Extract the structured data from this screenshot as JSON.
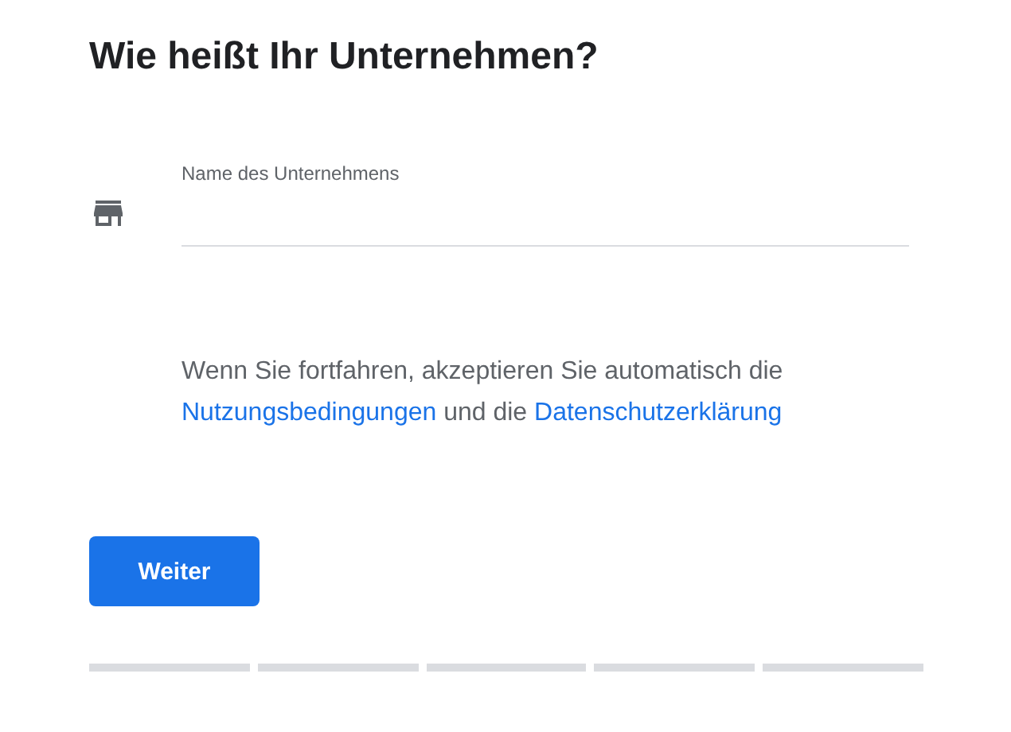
{
  "title": "Wie heißt Ihr Unternehmen?",
  "field": {
    "label": "Name des Unternehmens"
  },
  "terms": [
    {
      "kind": "text",
      "text": "Wenn Sie fortfahren, akzeptieren Sie automatisch die "
    },
    {
      "kind": "link",
      "text": "Nutzungsbedingungen"
    },
    {
      "kind": "text",
      "text": " und die "
    },
    {
      "kind": "link",
      "text": "Datenschutzerklärung"
    }
  ],
  "button": "Weiter",
  "progress_steps": [
    {
      "completed": false
    },
    {
      "completed": false
    },
    {
      "completed": false
    },
    {
      "completed": false
    },
    {
      "completed": false
    }
  ]
}
